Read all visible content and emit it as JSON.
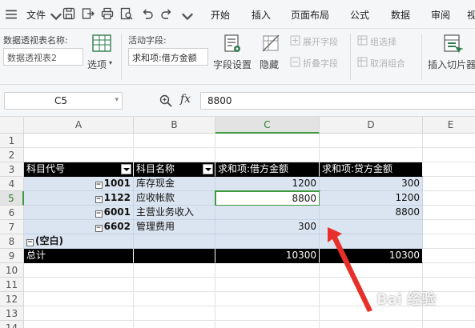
{
  "menubar": {
    "file_label": "文件",
    "tabs": [
      "开始",
      "插入",
      "页面布局",
      "公式",
      "数据",
      "审阅",
      "视"
    ]
  },
  "ribbon": {
    "pivot_name_label": "数据透视表名称:",
    "pivot_name_value": "数据透视表2",
    "options_label": "选项",
    "active_field_label": "活动字段:",
    "active_field_value": "求和项:借方金额",
    "field_settings_label": "字段设置",
    "hide_label": "隐藏",
    "expand_field_label": "展开字段",
    "collapse_field_label": "折叠字段",
    "group_select_label": "组选择",
    "ungroup_label": "取消组合",
    "insert_slicer_label": "插入切片器"
  },
  "formula_bar": {
    "cell_ref": "C5",
    "zoom_icon": "zoom-icon",
    "fx_label": "fx",
    "value": "8800"
  },
  "sheet": {
    "columns": [
      "A",
      "B",
      "C",
      "D",
      "E"
    ],
    "rows": [
      "1",
      "2",
      "3",
      "4",
      "5",
      "6",
      "7",
      "8",
      "9",
      "10",
      "11",
      "12",
      "13",
      "14"
    ],
    "pivot": {
      "headers": [
        "科目代号",
        "科目名称",
        "求和项:借方金额",
        "求和项:贷方金额"
      ],
      "items": [
        {
          "expander": "−",
          "code": "1001",
          "name": "库存现金",
          "debit": "1200",
          "credit": "300"
        },
        {
          "expander": "−",
          "code": "1122",
          "name": "应收帐款",
          "debit": "8800",
          "credit": "1200"
        },
        {
          "expander": "−",
          "code": "6001",
          "name": "主营业务收入",
          "debit": "",
          "credit": "8800"
        },
        {
          "expander": "−",
          "code": "6602",
          "name": "管理费用",
          "debit": "300",
          "credit": ""
        }
      ],
      "blank": {
        "expander": "−",
        "label": "(空白)"
      },
      "total": {
        "label": "总计",
        "debit": "10300",
        "credit": "10300"
      }
    },
    "active_cell": "C5"
  },
  "watermark": {
    "text": "Bai 经验"
  },
  "colors": {
    "accent": "#3f9a3f",
    "pivot_body": "#dbe5f1",
    "arrow": "#e8302a"
  }
}
